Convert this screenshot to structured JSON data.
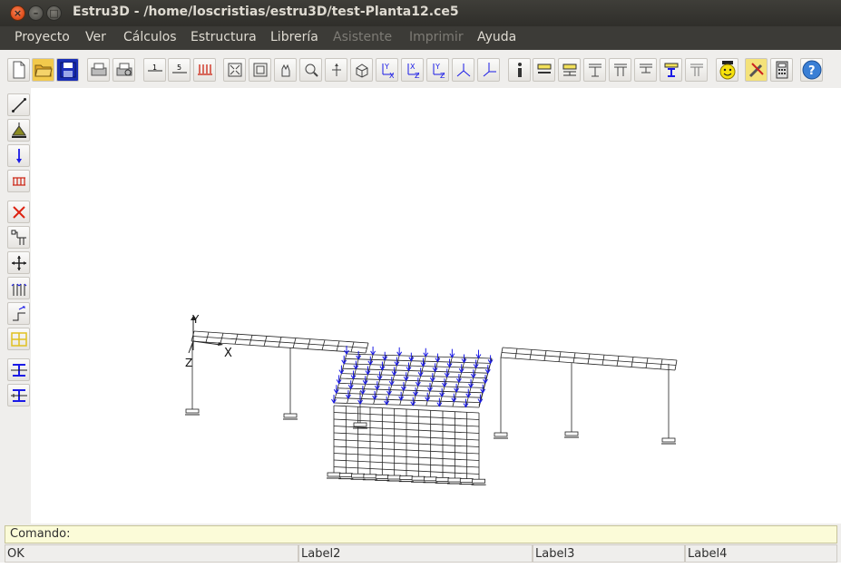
{
  "window": {
    "title": "Estru3D - /home/loscristias/estru3D/test-Planta12.ce5",
    "close_glyph": "×",
    "min_glyph": "–",
    "max_glyph": "□"
  },
  "menu": [
    {
      "label": "Proyecto",
      "enabled": true
    },
    {
      "label": "Ver",
      "enabled": true
    },
    {
      "label": "Cálculos",
      "enabled": true
    },
    {
      "label": "Estructura",
      "enabled": true
    },
    {
      "label": "Librería",
      "enabled": true
    },
    {
      "label": "Asistente",
      "enabled": false
    },
    {
      "label": "Imprimir",
      "enabled": false
    },
    {
      "label": "Ayuda",
      "enabled": true
    }
  ],
  "toolbar_icons": [
    "new-file-icon",
    "open-folder-icon",
    "save-icon",
    "print-icon",
    "print-preview-icon",
    "node-number-icon",
    "bar-number-icon",
    "load-values-icon",
    "zoom-extents-icon",
    "zoom-window-icon",
    "pan-icon",
    "zoom-icon",
    "rotate-icon",
    "view-3d-icon",
    "view-xy-icon",
    "view-zx-icon",
    "view-yz-icon",
    "view-xyz-icon",
    "axes-icon",
    "info-icon",
    "section-1-icon",
    "section-2-icon",
    "section-3-icon",
    "section-4-icon",
    "section-5-icon",
    "section-6-icon",
    "section-7-icon",
    "smiley-icon",
    "tools-icon",
    "calculator-icon",
    "help-icon"
  ],
  "side_icons": [
    "draw-bar-icon",
    "support-icon",
    "point-load-icon",
    "distributed-load-icon",
    "delete-icon",
    "nodes-icon",
    "move-icon",
    "mirror-icon",
    "copy-icon",
    "grid-icon",
    "beam-section-icon",
    "beam-section-2-icon"
  ],
  "axes": {
    "y": "Y",
    "x": "X",
    "z": "Z"
  },
  "command": {
    "label": "Comando:",
    "value": ""
  },
  "statusbar": [
    {
      "label": "OK"
    },
    {
      "label": "Label2"
    },
    {
      "label": "Label3"
    },
    {
      "label": "Label4"
    }
  ],
  "colors": {
    "titlebar": "#3c3b37",
    "menu_text": "#dfdbd2",
    "menu_disabled": "#7d7b75",
    "load_arrows": "#1a1ae6",
    "structure": "#222222",
    "command_bg": "#fbfbd8"
  }
}
